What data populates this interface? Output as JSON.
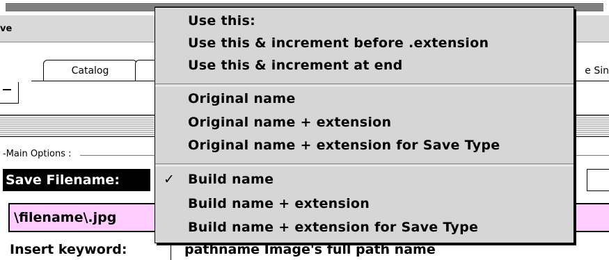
{
  "window": {
    "toolbar_label": "ve"
  },
  "tabs": [
    {
      "label": "Catalog"
    },
    {
      "label": ""
    }
  ],
  "tab_right_text": "e Sin",
  "main_options_label": "-Main Options :",
  "save_filename_label": "Save Filename:",
  "filename_value": "\\filename\\.jpg",
  "insert_keyword_label": "Insert keyword:",
  "pathname_hint": "pathname Image's full path name",
  "menu": {
    "groups": [
      {
        "items": [
          {
            "label": "Use this:",
            "checked": false
          },
          {
            "label": "Use this & increment before .extension",
            "checked": false
          },
          {
            "label": "Use this & increment at end",
            "checked": false
          }
        ]
      },
      {
        "items": [
          {
            "label": "Original name",
            "checked": false
          },
          {
            "label": "Original name + extension",
            "checked": false
          },
          {
            "label": "Original name + extension for Save Type",
            "checked": false
          }
        ]
      },
      {
        "items": [
          {
            "label": "Build name",
            "checked": true
          },
          {
            "label": "Build name + extension",
            "checked": false
          },
          {
            "label": "Build name + extension for Save Type",
            "checked": false
          }
        ]
      }
    ],
    "check_glyph": "✓"
  }
}
